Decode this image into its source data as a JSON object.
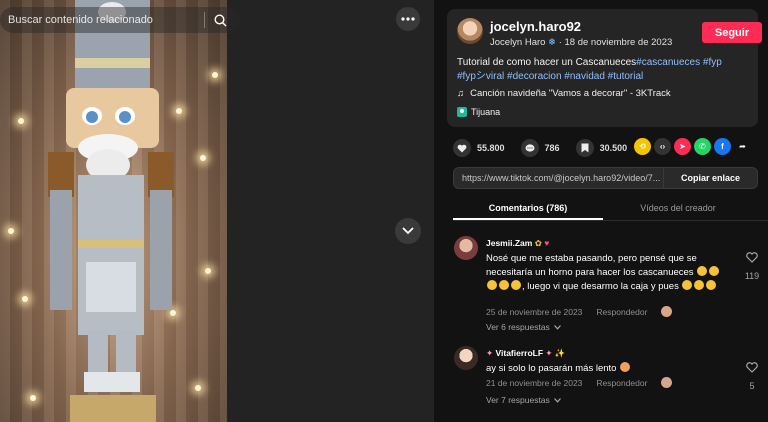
{
  "search": {
    "placeholder": "Buscar contenido relacionado"
  },
  "post": {
    "handle": "jocelyn.haro92",
    "display_name": "Jocelyn Haro",
    "date": "18 de noviembre de 2023",
    "follow_label": "Seguir",
    "caption_text": "Tutorial de como hacer un Cascanueces",
    "hashtags": [
      "#cascanueces",
      "#fyp",
      "#fypシviral",
      "#decoracion",
      "#navidad",
      "#tutorial"
    ],
    "music": "Canción navideña \"Vamos a decorar\" - 3KTrack",
    "location": "Tijuana"
  },
  "stats": {
    "likes": "55.800",
    "comments": "786",
    "saves": "30.500"
  },
  "share": {
    "link": "https://www.tiktok.com/@jocelyn.haro92/video/7...",
    "copy_label": "Copiar enlace"
  },
  "tabs": [
    {
      "label": "Comentarios (786)",
      "active": true
    },
    {
      "label": "Vídeos del creador",
      "active": false
    }
  ],
  "comments": [
    {
      "author": "Jesmii.Zam",
      "text": "Nosé que me estaba pasando, pero pensé que se necesitaría un horno para hacer los cascanueces",
      "text_2": ", luego vi que desarmo la caja y pues",
      "date": "25 de noviembre de 2023",
      "reply_label": "Respondedor",
      "replies": "Ver 6 respuestas",
      "likes": "119"
    },
    {
      "author": "VitafierroLF",
      "text": "ay si solo lo pasarán más lento",
      "date": "21 de noviembre de 2023",
      "reply_label": "Respondedor",
      "replies": "Ver 7 respuestas",
      "likes": "5"
    }
  ],
  "colors": {
    "accent": "#fe2c55",
    "panel": "#121212",
    "card": "#252525",
    "hashtag": "#8fbfff"
  }
}
